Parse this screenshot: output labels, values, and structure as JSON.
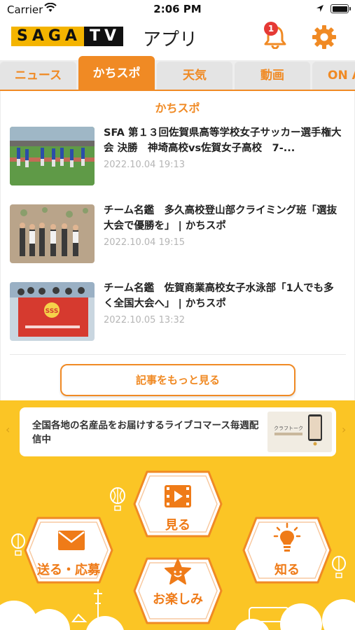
{
  "status_bar": {
    "carrier": "Carrier",
    "time": "2:06 PM"
  },
  "header": {
    "logo_left": "SAGA",
    "logo_right": "TV",
    "title": "アプリ",
    "notification_count": "1"
  },
  "tabs": [
    {
      "label": "ニュース"
    },
    {
      "label": "かちスポ"
    },
    {
      "label": "天気"
    },
    {
      "label": "動画"
    },
    {
      "label": "ON A"
    }
  ],
  "section": {
    "title": "かちスポ"
  },
  "articles": [
    {
      "title": "SFA 第１３回佐賀県高等学校女子サッカー選手権大会 決勝　神埼高校vs佐賀女子高校　7-...",
      "date": "2022.10.04 19:13"
    },
    {
      "title": "チーム名鑑　多久高校登山部クライミング班「選抜大会で優勝を」 | かちスポ",
      "date": "2022.10.04 19:15"
    },
    {
      "title": "チーム名鑑　佐賀商業高校女子水泳部「1人でも多く全国大会へ」 | かちスポ",
      "date": "2022.10.05 13:32"
    }
  ],
  "more_button": {
    "label": "記事をもっと見る"
  },
  "banner": {
    "text": "全国各地の名産品をお届けするライブコマース毎週配信中",
    "image_text": "クラフトーク"
  },
  "menu": {
    "watch": "見る",
    "send": "送る・応募",
    "know": "知る",
    "enjoy": "お楽しみ"
  },
  "colors": {
    "accent": "#f08a24",
    "yellow": "#fbc525",
    "badge": "#e53935"
  }
}
